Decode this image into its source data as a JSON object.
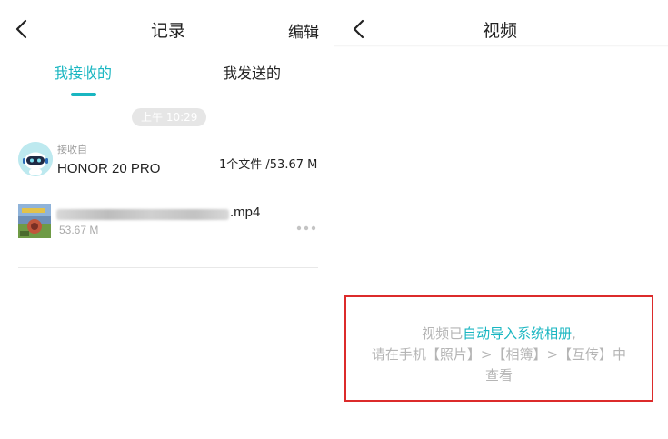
{
  "left_screen": {
    "title": "记录",
    "edit_label": "编辑",
    "tabs": [
      {
        "label": "我接收的",
        "active": true
      },
      {
        "label": "我发送的",
        "active": false
      }
    ],
    "time_label": "上午 10:29",
    "sender": {
      "caption": "接收自",
      "name": "HONOR 20 PRO",
      "summary": "1个文件 /53.67 M"
    },
    "file": {
      "extension": ".mp4",
      "size": "53.67 M"
    }
  },
  "right_screen": {
    "title": "视频",
    "notice": {
      "prefix": "视频已",
      "link": "自动导入系统相册",
      "suffix": ",",
      "line2": "请在手机【照片】>【相簿】>【互传】中",
      "line3": "查看"
    }
  },
  "colors": {
    "accent": "#19b6c1",
    "highlight_border": "#dc2b2b"
  }
}
